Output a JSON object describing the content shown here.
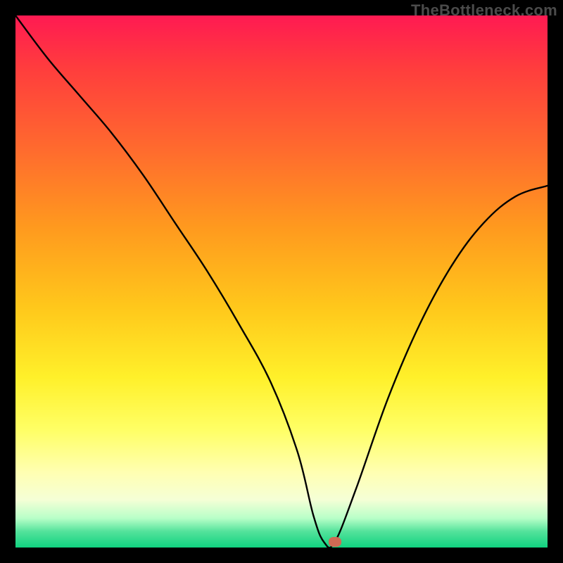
{
  "watermark": "TheBottleneck.com",
  "chart_data": {
    "type": "line",
    "title": "",
    "xlabel": "",
    "ylabel": "",
    "xlim": [
      0,
      100
    ],
    "ylim": [
      0,
      100
    ],
    "series": [
      {
        "name": "curve",
        "x": [
          0,
          6,
          12,
          18,
          24,
          30,
          36,
          42,
          48,
          53,
          56,
          58,
          60,
          64,
          70,
          76,
          82,
          88,
          94,
          100
        ],
        "values": [
          100,
          92,
          85,
          78,
          70,
          61,
          52,
          42,
          31,
          18,
          6,
          1,
          1,
          11,
          28,
          42,
          53,
          61,
          66,
          68
        ]
      }
    ],
    "marker": {
      "x": 60,
      "y": 1
    },
    "background_gradient": {
      "top": "#ff1a52",
      "mid": "#ffff66",
      "bottom": "#10d280"
    }
  }
}
